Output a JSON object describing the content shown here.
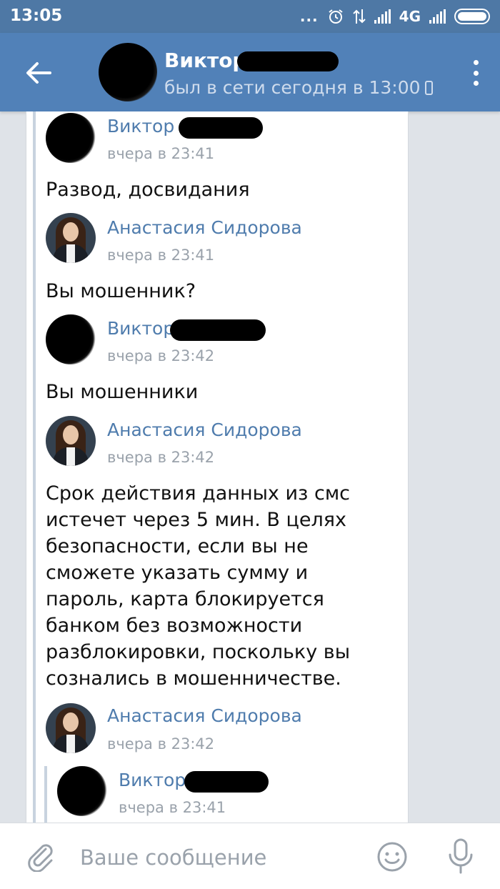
{
  "status_bar": {
    "time": "13:05",
    "dots": "...",
    "network": "4G"
  },
  "header": {
    "contact_name": "Виктор",
    "last_seen": "был в сети сегодня в 13:00"
  },
  "messages": [
    {
      "sender": "Виктор",
      "time": "вчера в 23:41",
      "text": "Развод, досвидания",
      "avatar": "redacted"
    },
    {
      "sender": "Анастасия Сидорова",
      "time": "вчера в 23:41",
      "text": "Вы мошенник?",
      "avatar": "photo"
    },
    {
      "sender": "Виктор",
      "time": "вчера в 23:42",
      "text": "Вы мошенники",
      "avatar": "redacted"
    },
    {
      "sender": "Анастасия Сидорова",
      "time": "вчера в 23:42",
      "text": "Срок действия данных из смс истечет через 5 мин. В целях безопасности, если вы не сможете указать сумму и пароль, карта блокируется банком без возможности разблокировки, поскольку вы сознались в мошенничестве.",
      "avatar": "photo"
    },
    {
      "sender": "Анастасия Сидорова",
      "time": "вчера в 23:42",
      "text": "",
      "avatar": "photo"
    },
    {
      "sender": "Виктор",
      "time": "вчера в 23:41",
      "text": "",
      "avatar": "redacted"
    }
  ],
  "composer": {
    "placeholder": "Ваше сообщение"
  },
  "colors": {
    "header": "#5181b8",
    "status_bar": "#4e78a5",
    "sender_link": "#4f7cad",
    "time_gray": "#9aa2ab"
  }
}
